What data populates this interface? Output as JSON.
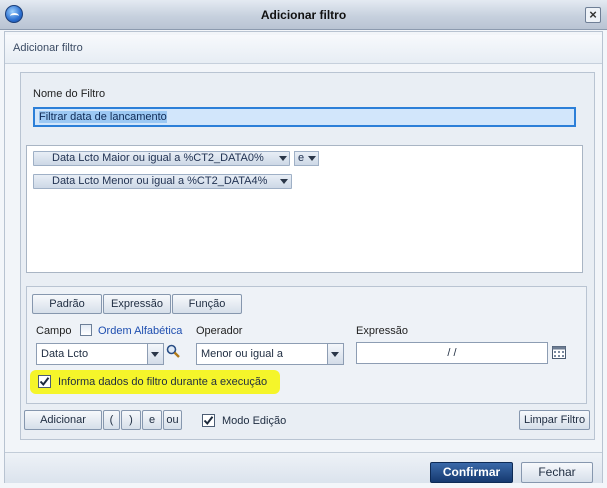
{
  "window": {
    "title": "Adicionar filtro",
    "close_symbol": "×"
  },
  "header": {
    "text": "Adicionar filtro"
  },
  "form": {
    "name_label": "Nome do Filtro",
    "name_value": "Filtrar data de lancamento"
  },
  "conditions": [
    {
      "text": "Data Lcto Maior ou igual a %CT2_DATA0%"
    },
    {
      "text": "Data Lcto Menor ou igual a %CT2_DATA4%"
    }
  ],
  "conjunction": "e",
  "mode_buttons": {
    "padrao": "Padrão",
    "expressao": "Expressão",
    "funcao": "Função"
  },
  "fields": {
    "campo_label": "Campo",
    "ordem_label": "Ordem Alfabética",
    "operador_label": "Operador",
    "expressao_label": "Expressão",
    "campo_value": "Data Lcto",
    "operador_value": "Menor ou igual a",
    "expressao_value": "/ /"
  },
  "options": {
    "informa_label": "Informa dados do filtro durante a execução",
    "informa_checked": true,
    "modo_label": "Modo Edição",
    "modo_checked": true
  },
  "actions": {
    "adicionar": "Adicionar",
    "open_paren": "(",
    "close_paren": ")",
    "e": "e",
    "ou": "ou",
    "limpar": "Limpar Filtro"
  },
  "footer": {
    "confirmar": "Confirmar",
    "fechar": "Fechar"
  },
  "colors": {
    "highlight": "#f5f52a",
    "accent": "#2c7fd8",
    "confirm": "#15396f"
  }
}
